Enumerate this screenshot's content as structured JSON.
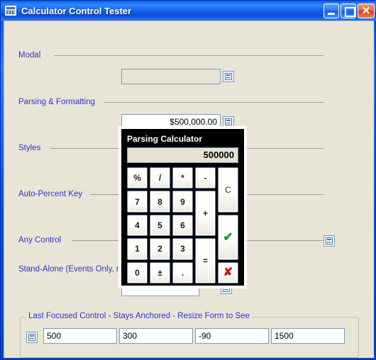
{
  "window": {
    "title": "Calculator Control Tester",
    "icon": "calculator-icon",
    "minimize_label": "_",
    "maximize_label": "□",
    "close_label": "✕",
    "background_color": "#e9e5d6",
    "title_color": "#ffffff",
    "accent_color": "#2f86ff",
    "label_color": "#3333cc"
  },
  "sections": [
    {
      "label": "Modal"
    },
    {
      "label": "Parsing & Formatting"
    },
    {
      "label": "Styles"
    },
    {
      "label": "Auto-Percent Key"
    },
    {
      "label": "Any Control"
    },
    {
      "label": "Stand-Alone (Events Only, n"
    }
  ],
  "fields": {
    "modal": {
      "value": "",
      "placeholder": ""
    },
    "parsing": {
      "value": "$500,000.00",
      "placeholder": ""
    },
    "standalone": {
      "value": "",
      "placeholder": ""
    }
  },
  "calculator": {
    "title": "Parsing Calculator",
    "display": "500000",
    "keys": {
      "percent": "%",
      "divide": "/",
      "multiply": "*",
      "minus": "-",
      "clear": "C",
      "seven": "7",
      "eight": "8",
      "nine": "9",
      "plus": "+",
      "four": "4",
      "five": "5",
      "six": "6",
      "accept": "✔",
      "one": "1",
      "two": "2",
      "three": "3",
      "equals": "=",
      "zero": "0",
      "sign": "±",
      "decimal": ".",
      "cancel": "✘"
    },
    "accept_color": "#0f9b22",
    "cancel_color": "#cc1111",
    "display_bg": "#e6e2d2",
    "panel_bg": "#000000"
  },
  "groupbox": {
    "title": "Last Focused Control - Stays Anchored - Resize Form to See",
    "fields": [
      {
        "value": "500"
      },
      {
        "value": "300"
      },
      {
        "value": "-90"
      },
      {
        "value": "1500"
      }
    ]
  }
}
